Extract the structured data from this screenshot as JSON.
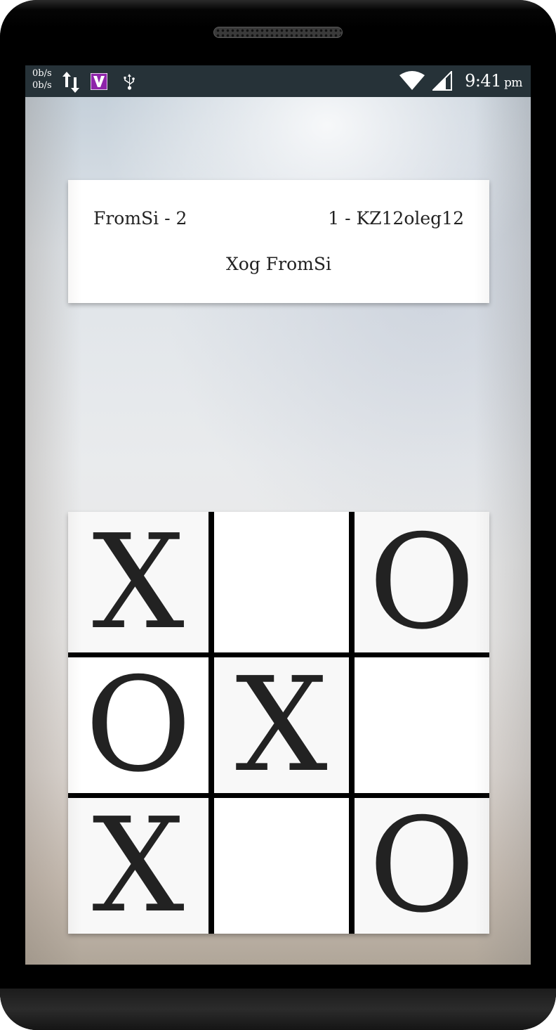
{
  "status_bar": {
    "net_up": "0b/s",
    "net_down": "0b/s",
    "time": "9:41",
    "ampm": "pm",
    "icons": [
      "data-transfer-arrows-icon",
      "app-v-icon",
      "usb-icon",
      "wifi-icon",
      "cell-signal-icon"
    ],
    "app_icon_color": "#7b1fa2"
  },
  "scoreboard": {
    "player_left": "FromSi - 2",
    "player_right": "1 - KZ12oleg12",
    "turn_text": "Xog FromSi"
  },
  "board": {
    "cells": [
      "X",
      "",
      "O",
      "O",
      "X",
      "",
      "X",
      "",
      "O"
    ]
  },
  "colors": {
    "status_bar_bg": "#263238",
    "text": "#222222",
    "grid_line": "#000000"
  }
}
